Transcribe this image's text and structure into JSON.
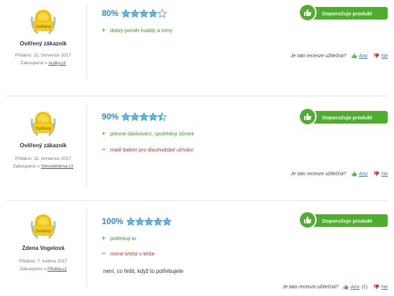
{
  "common": {
    "recommend_label": "Doporučuje produkt",
    "helpful_question": "Je tato recenze užitečná?",
    "yes_label": "Ano",
    "no_label": "Ne",
    "purchased_prefix": "Zakoupeno v",
    "added_prefix": "Přidáno:",
    "badge_text": "Ověřený",
    "colors": {
      "green": "#4caf2c",
      "blue": "#2a8ec9",
      "red": "#d4322a",
      "gold": "#f2c200"
    }
  },
  "reviews": [
    {
      "user": "Ověřený zákazník",
      "date": "11. července 2017",
      "shop": "sLéky.cz",
      "percent": "80%",
      "rating": 4,
      "pros": [
        "dobrý poměr kvality a ceny"
      ],
      "cons": [],
      "comment": "",
      "yes_count": ""
    },
    {
      "user": "Ověřený zákazník",
      "date": "11. července 2017",
      "shop": "Slevolékárna.cz",
      "percent": "90%",
      "rating": 4.5,
      "pros": [
        "přesné dávkování, spolehlivý účinek"
      ],
      "cons": [
        "malé balení pro dlouhodobé užívání"
      ],
      "comment": "",
      "yes_count": ""
    },
    {
      "user": "Zdena Vogelová",
      "date": "7. května 2017",
      "shop": "Pilulka.cz",
      "percent": "100%",
      "rating": 5,
      "pros": [
        "potřebuji to"
      ],
      "cons": [
        "mírné křeče v břiše"
      ],
      "comment": "není, co řešit, když to potřebujete",
      "yes_count": "(1)"
    }
  ]
}
